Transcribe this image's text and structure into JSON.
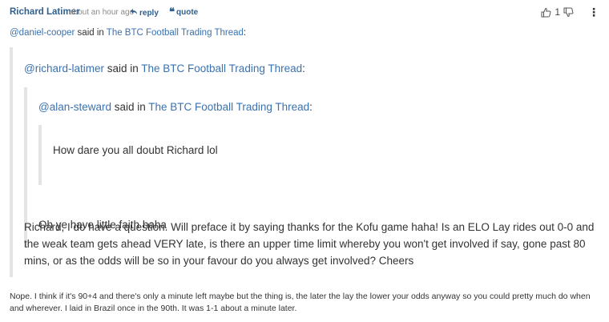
{
  "post": {
    "author": "Richard Latimer",
    "time": "about an hour ago",
    "reply_label": "reply",
    "quote_label": "quote",
    "vote_count": "1"
  },
  "top_attribution": {
    "user": "@daniel-cooper",
    "said_in": " said in ",
    "thread": "The BTC Football Trading Thread",
    "colon": ":"
  },
  "quote_level1": {
    "user": "@richard-latimer",
    "said_in": " said in ",
    "thread": "The BTC Football Trading Thread",
    "colon": ":",
    "paragraph": "Richard, I do have a question. Will preface it by saying thanks for the Kofu game haha! Is an ELO Lay rides out 0-0 and the weak team gets ahead VERY late, is there an upper time limit whereby you won't get involved if say, gone past 80 mins, or as the odds will be so in your favour do you always get involved? Cheers"
  },
  "quote_level2": {
    "user": "@alan-steward",
    "said_in": " said in ",
    "thread": "The BTC Football Trading Thread",
    "colon": ":",
    "text": "Oh ye have little faith haha"
  },
  "quote_level3": {
    "text": "How dare you all doubt Richard lol"
  },
  "reply_text": "Nope. I think if it's 90+4 and there's only a minute left maybe but the thing is, the later the lay the lower your odds anyway so you could pretty much do when and wherever. I laid in Brazil once in the 90th. It was 1-1 about a minute later."
}
